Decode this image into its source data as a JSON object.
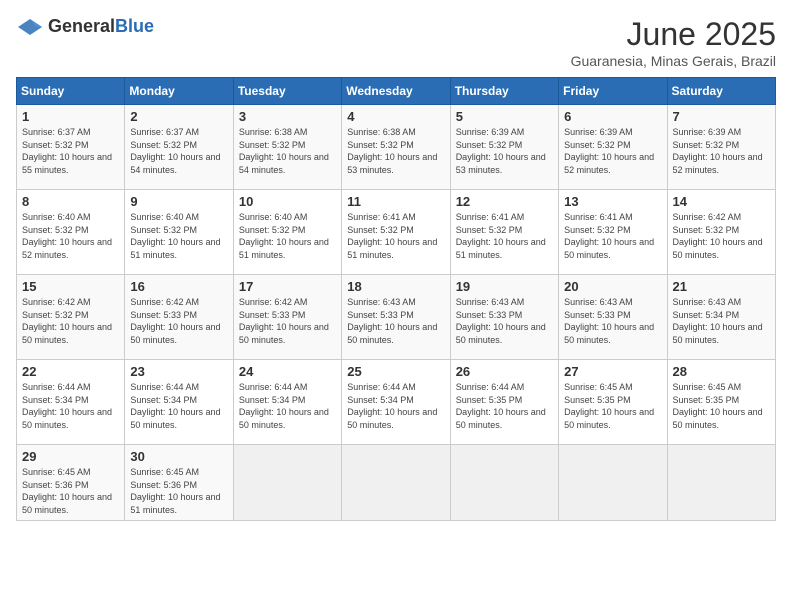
{
  "header": {
    "logo_general": "General",
    "logo_blue": "Blue",
    "month_title": "June 2025",
    "location": "Guaranesia, Minas Gerais, Brazil"
  },
  "weekdays": [
    "Sunday",
    "Monday",
    "Tuesday",
    "Wednesday",
    "Thursday",
    "Friday",
    "Saturday"
  ],
  "weeks": [
    [
      {
        "day": "1",
        "sunrise": "6:37 AM",
        "sunset": "5:32 PM",
        "daylight": "10 hours and 55 minutes."
      },
      {
        "day": "2",
        "sunrise": "6:37 AM",
        "sunset": "5:32 PM",
        "daylight": "10 hours and 54 minutes."
      },
      {
        "day": "3",
        "sunrise": "6:38 AM",
        "sunset": "5:32 PM",
        "daylight": "10 hours and 54 minutes."
      },
      {
        "day": "4",
        "sunrise": "6:38 AM",
        "sunset": "5:32 PM",
        "daylight": "10 hours and 53 minutes."
      },
      {
        "day": "5",
        "sunrise": "6:39 AM",
        "sunset": "5:32 PM",
        "daylight": "10 hours and 53 minutes."
      },
      {
        "day": "6",
        "sunrise": "6:39 AM",
        "sunset": "5:32 PM",
        "daylight": "10 hours and 52 minutes."
      },
      {
        "day": "7",
        "sunrise": "6:39 AM",
        "sunset": "5:32 PM",
        "daylight": "10 hours and 52 minutes."
      }
    ],
    [
      {
        "day": "8",
        "sunrise": "6:40 AM",
        "sunset": "5:32 PM",
        "daylight": "10 hours and 52 minutes."
      },
      {
        "day": "9",
        "sunrise": "6:40 AM",
        "sunset": "5:32 PM",
        "daylight": "10 hours and 51 minutes."
      },
      {
        "day": "10",
        "sunrise": "6:40 AM",
        "sunset": "5:32 PM",
        "daylight": "10 hours and 51 minutes."
      },
      {
        "day": "11",
        "sunrise": "6:41 AM",
        "sunset": "5:32 PM",
        "daylight": "10 hours and 51 minutes."
      },
      {
        "day": "12",
        "sunrise": "6:41 AM",
        "sunset": "5:32 PM",
        "daylight": "10 hours and 51 minutes."
      },
      {
        "day": "13",
        "sunrise": "6:41 AM",
        "sunset": "5:32 PM",
        "daylight": "10 hours and 50 minutes."
      },
      {
        "day": "14",
        "sunrise": "6:42 AM",
        "sunset": "5:32 PM",
        "daylight": "10 hours and 50 minutes."
      }
    ],
    [
      {
        "day": "15",
        "sunrise": "6:42 AM",
        "sunset": "5:32 PM",
        "daylight": "10 hours and 50 minutes."
      },
      {
        "day": "16",
        "sunrise": "6:42 AM",
        "sunset": "5:33 PM",
        "daylight": "10 hours and 50 minutes."
      },
      {
        "day": "17",
        "sunrise": "6:42 AM",
        "sunset": "5:33 PM",
        "daylight": "10 hours and 50 minutes."
      },
      {
        "day": "18",
        "sunrise": "6:43 AM",
        "sunset": "5:33 PM",
        "daylight": "10 hours and 50 minutes."
      },
      {
        "day": "19",
        "sunrise": "6:43 AM",
        "sunset": "5:33 PM",
        "daylight": "10 hours and 50 minutes."
      },
      {
        "day": "20",
        "sunrise": "6:43 AM",
        "sunset": "5:33 PM",
        "daylight": "10 hours and 50 minutes."
      },
      {
        "day": "21",
        "sunrise": "6:43 AM",
        "sunset": "5:34 PM",
        "daylight": "10 hours and 50 minutes."
      }
    ],
    [
      {
        "day": "22",
        "sunrise": "6:44 AM",
        "sunset": "5:34 PM",
        "daylight": "10 hours and 50 minutes."
      },
      {
        "day": "23",
        "sunrise": "6:44 AM",
        "sunset": "5:34 PM",
        "daylight": "10 hours and 50 minutes."
      },
      {
        "day": "24",
        "sunrise": "6:44 AM",
        "sunset": "5:34 PM",
        "daylight": "10 hours and 50 minutes."
      },
      {
        "day": "25",
        "sunrise": "6:44 AM",
        "sunset": "5:34 PM",
        "daylight": "10 hours and 50 minutes."
      },
      {
        "day": "26",
        "sunrise": "6:44 AM",
        "sunset": "5:35 PM",
        "daylight": "10 hours and 50 minutes."
      },
      {
        "day": "27",
        "sunrise": "6:45 AM",
        "sunset": "5:35 PM",
        "daylight": "10 hours and 50 minutes."
      },
      {
        "day": "28",
        "sunrise": "6:45 AM",
        "sunset": "5:35 PM",
        "daylight": "10 hours and 50 minutes."
      }
    ],
    [
      {
        "day": "29",
        "sunrise": "6:45 AM",
        "sunset": "5:36 PM",
        "daylight": "10 hours and 50 minutes."
      },
      {
        "day": "30",
        "sunrise": "6:45 AM",
        "sunset": "5:36 PM",
        "daylight": "10 hours and 51 minutes."
      },
      {
        "day": "",
        "sunrise": "",
        "sunset": "",
        "daylight": ""
      },
      {
        "day": "",
        "sunrise": "",
        "sunset": "",
        "daylight": ""
      },
      {
        "day": "",
        "sunrise": "",
        "sunset": "",
        "daylight": ""
      },
      {
        "day": "",
        "sunrise": "",
        "sunset": "",
        "daylight": ""
      },
      {
        "day": "",
        "sunrise": "",
        "sunset": "",
        "daylight": ""
      }
    ]
  ]
}
